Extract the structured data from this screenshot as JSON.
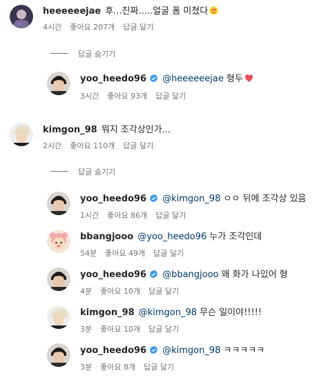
{
  "comments": [
    {
      "user": "heeeeeejae",
      "text": "후...진짜.....얼굴 폼 미쳤다",
      "emoji": "heart-eyes",
      "time": "4시간",
      "likes": "좋아요 207개",
      "reply": "답글 달기"
    },
    {
      "user": "yoo_heedo96",
      "verified": true,
      "mention": "@heeeeeejae",
      "text": "형두",
      "emoji": "red-heart",
      "time": "3시간",
      "likes": "좋아요 93개",
      "reply": "답글 달기"
    },
    {
      "user": "kimgon_98",
      "text": "뭐지 조각상인가...",
      "time": "2시간",
      "likes": "좋아요 110개",
      "reply": "답글 달기"
    },
    {
      "user": "yoo_heedo96",
      "verified": true,
      "mention": "@kimgon_98",
      "text": "ㅇㅇ 뒤에 조각상 있음",
      "time": "1시간",
      "likes": "좋아요 86개",
      "reply": "답글 달기"
    },
    {
      "user": "bbangjooo",
      "mention": "@yoo_heedo96",
      "text": "누가 조각인데",
      "time": "54분",
      "likes": "좋아요 49개",
      "reply": "답글 달기"
    },
    {
      "user": "yoo_heedo96",
      "verified": true,
      "mention": "@bbangjooo",
      "text": "왜 화가 나있어 형",
      "time": "4분",
      "likes": "좋아요 10개",
      "reply": "답글 달기"
    },
    {
      "user": "kimgon_98",
      "mention": "@kimgon_98",
      "text": "무슨 일이야!!!!!",
      "time": "3분",
      "likes": "좋아요 10개",
      "reply": "답글 달기"
    },
    {
      "user": "yoo_heedo96",
      "verified": true,
      "mention": "@kimgon_98",
      "text": "ㅋㅋㅋㅋㅋ",
      "time": "3분",
      "likes": "좋아요 8개",
      "reply": "답글 달기"
    }
  ],
  "hide_replies_label": "답글 숨기기",
  "colors": {
    "verified": "#3897f0",
    "mention": "#00376b",
    "meta": "#737373",
    "heart": "#ed4956"
  }
}
